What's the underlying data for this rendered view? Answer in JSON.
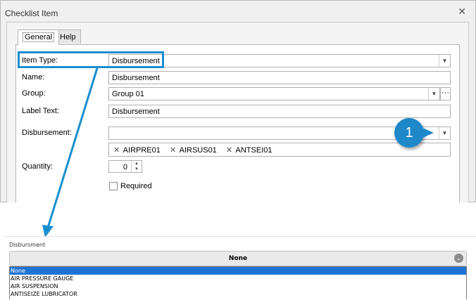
{
  "window": {
    "title": "Checklist Item"
  },
  "tabs": [
    {
      "label": "General"
    },
    {
      "label": "Help"
    }
  ],
  "form": {
    "item_type": {
      "label": "Item Type:",
      "value": "Disbursement"
    },
    "name": {
      "label": "Name:",
      "value": "Disbursement"
    },
    "group": {
      "label": "Group:",
      "value": "Group 01"
    },
    "label_text": {
      "label": "Label Text:",
      "value": "Disbursement"
    },
    "disbursement": {
      "label": "Disbursement:",
      "value": "",
      "tags": [
        "AIRPRE01",
        "AIRSUS01",
        "ANTSEI01"
      ]
    },
    "quantity": {
      "label": "Quantity:",
      "value": "0"
    },
    "required": {
      "label": "Required",
      "checked": false
    }
  },
  "callout": {
    "number": "1",
    "color": "#1e88c8"
  },
  "web_form": {
    "label": "Disbursment",
    "selected": "None",
    "options": [
      "None",
      "AIR PRESSURE GAUGE",
      "AIR SUSPENSION",
      "ANTISEIZE LUBRICATOR"
    ]
  },
  "colors": {
    "accent": "#1a8fcf",
    "list_selection": "#1e74d4"
  }
}
